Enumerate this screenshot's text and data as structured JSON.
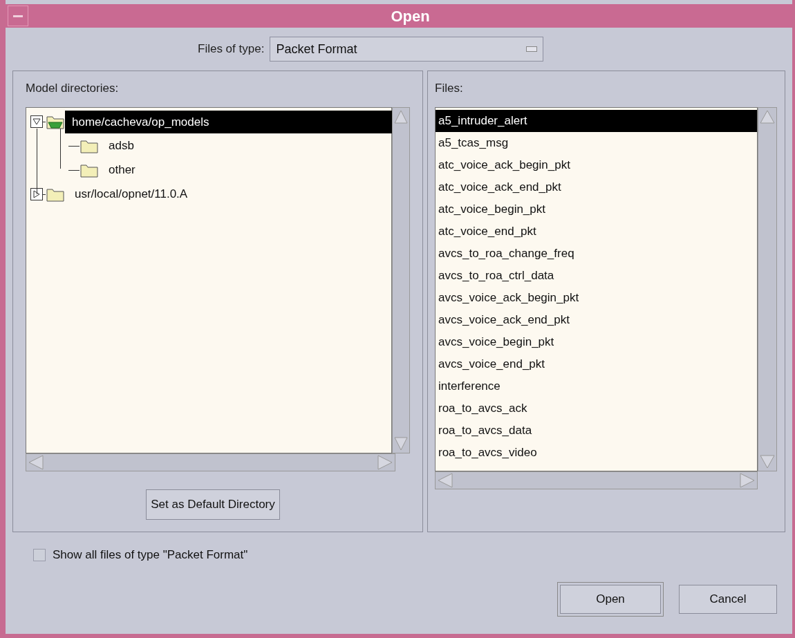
{
  "window": {
    "title": "Open"
  },
  "file_type": {
    "label": "Files of type:",
    "value": "Packet Format"
  },
  "directories": {
    "label": "Model directories:",
    "items": [
      {
        "label": "home/cacheva/op_models",
        "expanded": true,
        "selected": true,
        "children": [
          {
            "label": "adsb",
            "selected": false
          },
          {
            "label": "other",
            "selected": false
          }
        ]
      },
      {
        "label": "usr/local/opnet/11.0.A",
        "expanded": false,
        "selected": false
      }
    ]
  },
  "default_button": "Set as Default Directory",
  "files": {
    "label": "Files:",
    "items": [
      {
        "name": "a5_intruder_alert",
        "selected": true
      },
      {
        "name": "a5_tcas_msg",
        "selected": false
      },
      {
        "name": "atc_voice_ack_begin_pkt",
        "selected": false
      },
      {
        "name": "atc_voice_ack_end_pkt",
        "selected": false
      },
      {
        "name": "atc_voice_begin_pkt",
        "selected": false
      },
      {
        "name": "atc_voice_end_pkt",
        "selected": false
      },
      {
        "name": "avcs_to_roa_change_freq",
        "selected": false
      },
      {
        "name": "avcs_to_roa_ctrl_data",
        "selected": false
      },
      {
        "name": "avcs_voice_ack_begin_pkt",
        "selected": false
      },
      {
        "name": "avcs_voice_ack_end_pkt",
        "selected": false
      },
      {
        "name": "avcs_voice_begin_pkt",
        "selected": false
      },
      {
        "name": "avcs_voice_end_pkt",
        "selected": false
      },
      {
        "name": "interference",
        "selected": false
      },
      {
        "name": "roa_to_avcs_ack",
        "selected": false
      },
      {
        "name": "roa_to_avcs_data",
        "selected": false
      },
      {
        "name": "roa_to_avcs_video",
        "selected": false
      }
    ]
  },
  "show_all": {
    "label": "Show all files of type \"Packet Format\"",
    "checked": false
  },
  "buttons": [
    "Open",
    "Cancel"
  ]
}
